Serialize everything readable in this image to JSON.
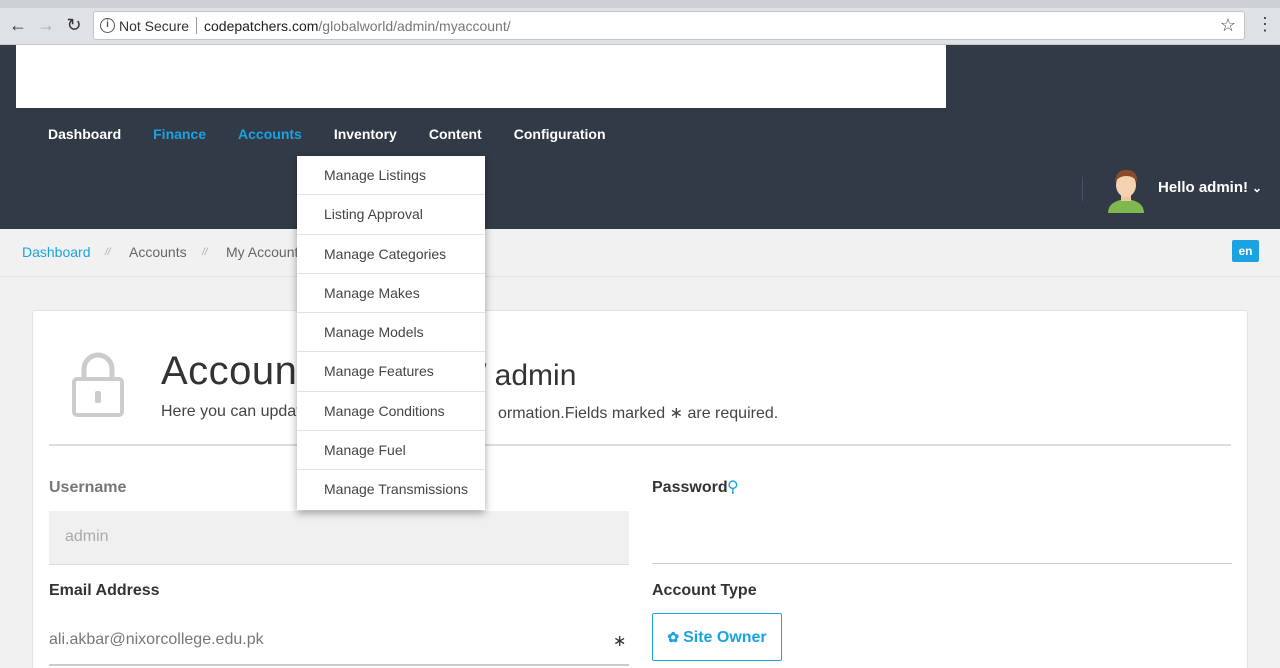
{
  "browser": {
    "security_label": "Not Secure",
    "url_host": "codepatchers.com",
    "url_path": "/globalworld/admin/myaccount/"
  },
  "nav": {
    "items": [
      {
        "label": "Dashboard"
      },
      {
        "label": "Finance"
      },
      {
        "label": "Accounts"
      },
      {
        "label": "Inventory"
      },
      {
        "label": "Content"
      },
      {
        "label": "Configuration"
      }
    ]
  },
  "user": {
    "greeting": "Hello admin!"
  },
  "breadcrumb": {
    "items": [
      {
        "label": "Dashboard"
      },
      {
        "label": "Accounts"
      },
      {
        "label": "My Account"
      }
    ],
    "separator": "//"
  },
  "language": "en",
  "page": {
    "title": "Account",
    "title_suffix": "/ admin",
    "subtitle_left": "Here you can update",
    "subtitle_right": "ormation.Fields marked ∗ are required."
  },
  "form": {
    "username_label": "Username",
    "username_value": "admin",
    "password_label": "Password",
    "email_label": "Email Address",
    "email_value": "ali.akbar@nixorcollege.edu.pk",
    "required_mark": "∗",
    "account_type_label": "Account Type",
    "account_type_value": "Site Owner"
  },
  "inventory_menu": {
    "items": [
      {
        "label": "Manage Listings"
      },
      {
        "label": "Listing Approval"
      },
      {
        "label": "Manage Categories"
      },
      {
        "label": "Manage Makes"
      },
      {
        "label": "Manage Models"
      },
      {
        "label": "Manage Features"
      },
      {
        "label": "Manage Conditions"
      },
      {
        "label": "Manage Fuel"
      },
      {
        "label": "Manage Transmissions"
      }
    ]
  },
  "colors": {
    "header_bg": "#323a48",
    "accent": "#1aa3e0"
  }
}
